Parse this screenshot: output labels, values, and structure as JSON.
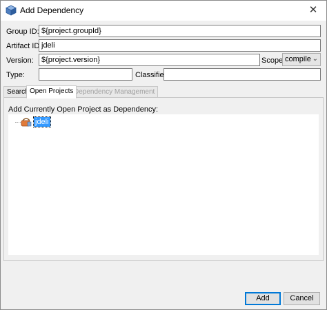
{
  "window": {
    "title": "Add Dependency",
    "close_glyph": "✕",
    "icon": "cube-icon"
  },
  "form": {
    "group_id_label": "Group ID:",
    "group_id_value": "${project.groupId}",
    "artifact_id_label": "Artifact ID:",
    "artifact_id_value": "jdeli",
    "version_label": "Version:",
    "version_value": "${project.version}",
    "scope_label": "Scope:",
    "scope_value": "compile",
    "type_label": "Type:",
    "type_value": "",
    "classifier_label": "Classifier:",
    "classifier_value": ""
  },
  "tabs": [
    {
      "label": "Search",
      "state": "normal"
    },
    {
      "label": "Open Projects",
      "state": "active"
    },
    {
      "label": "Dependency Management",
      "state": "disabled"
    }
  ],
  "panel": {
    "heading": "Add Currently Open Project as Dependency:",
    "projects": [
      {
        "label": "jdeli",
        "selected": true,
        "icon": "maven-project-icon"
      }
    ]
  },
  "buttons": {
    "add": "Add",
    "cancel": "Cancel"
  },
  "colors": {
    "selection": "#3399ff",
    "default_button_border": "#0078d7",
    "dialog_background": "#f0f0f0"
  }
}
